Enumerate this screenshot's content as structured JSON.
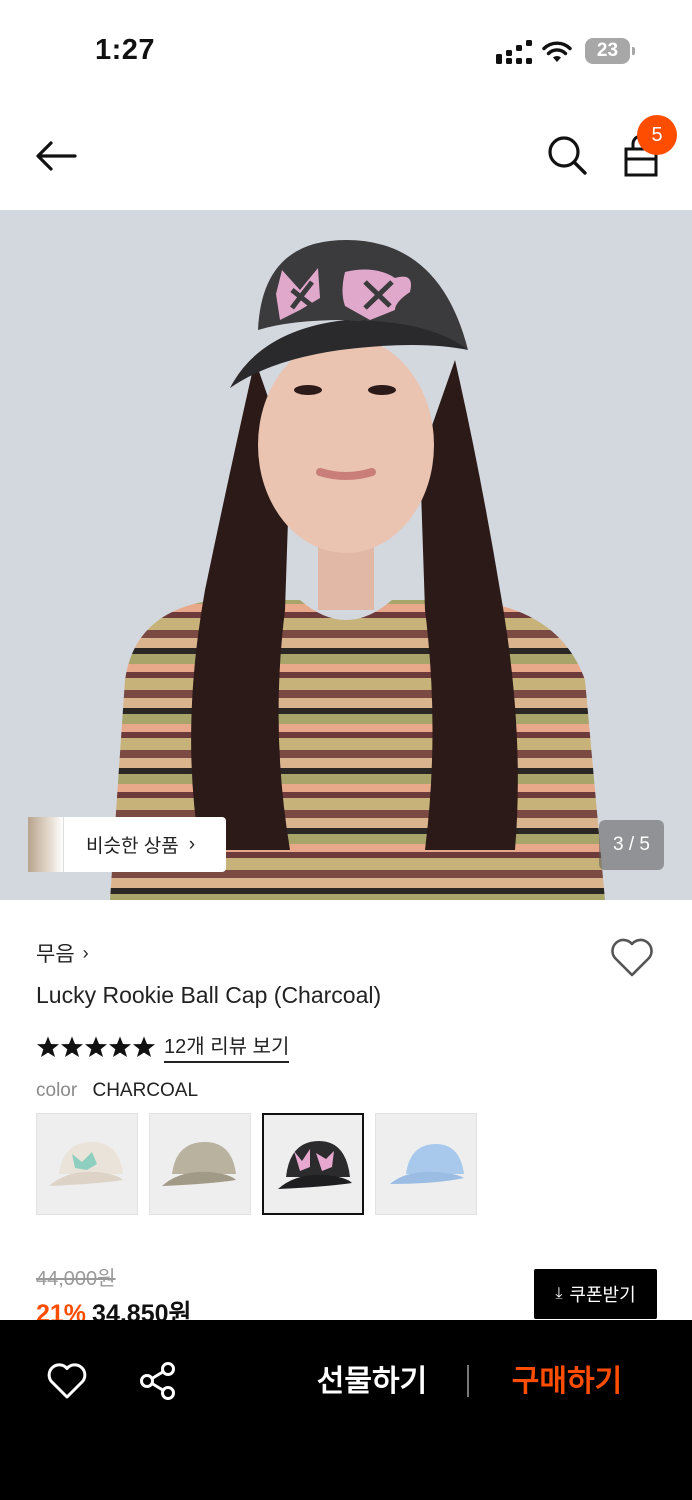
{
  "status_bar": {
    "time": "1:27",
    "battery": "23"
  },
  "header": {
    "cart_count": "5"
  },
  "gallery": {
    "similar_label": "비슷한 상품",
    "page_indicator": "3 / 5"
  },
  "product": {
    "brand": "무음",
    "title": "Lucky Rookie Ball Cap (Charcoal)",
    "rating_stars": 5,
    "review_link": "12개 리뷰 보기",
    "color_key": "color",
    "color_value": "CHARCOAL",
    "swatches": [
      {
        "color": "#eae3d9",
        "accent": "#8fcfc0"
      },
      {
        "color": "#b9b29f",
        "accent": "#a09a86"
      },
      {
        "color": "#2b2a2c",
        "accent": "#e7a8cf"
      },
      {
        "color": "#a8c9ec",
        "accent": "#ffffff"
      }
    ],
    "selected_swatch": 2,
    "price_original": "44,000원",
    "discount": "21%",
    "price": "34,850원",
    "coupon_label": "쿠폰받기"
  },
  "bottom_bar": {
    "gift_label": "선물하기",
    "buy_label": "구매하기"
  },
  "colors": {
    "accent": "#ff4d00",
    "bar": "#000000"
  }
}
